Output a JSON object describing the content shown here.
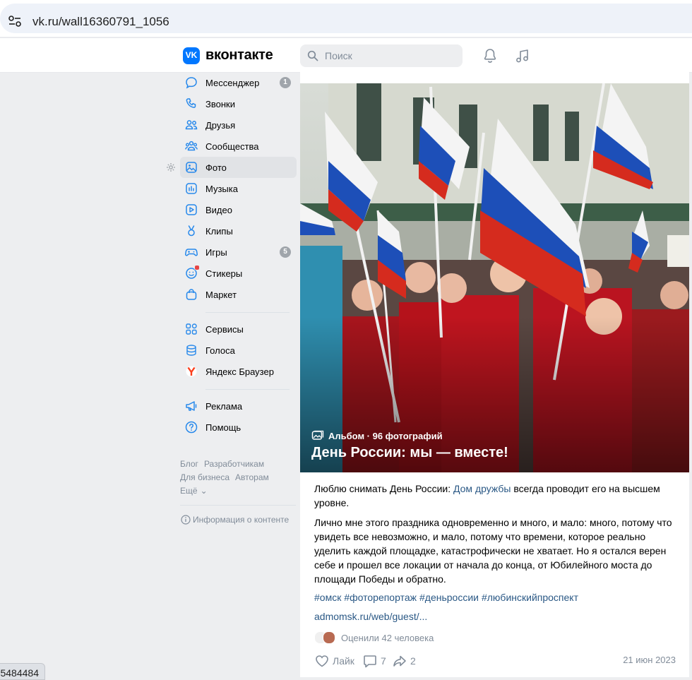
{
  "browser": {
    "url": "vk.ru/wall16360791_1056"
  },
  "header": {
    "logo_text": "вконтакте",
    "logo_mark": "VK",
    "search_placeholder": "Поиск"
  },
  "sidebar": {
    "items": [
      {
        "label": "Мессенджер",
        "icon": "chat-bubble-icon",
        "badge": "1"
      },
      {
        "label": "Звонки",
        "icon": "phone-icon"
      },
      {
        "label": "Друзья",
        "icon": "friends-icon"
      },
      {
        "label": "Сообщества",
        "icon": "communities-icon"
      },
      {
        "label": "Фото",
        "icon": "photo-icon",
        "active": true
      },
      {
        "label": "Музыка",
        "icon": "music-icon"
      },
      {
        "label": "Видео",
        "icon": "video-icon"
      },
      {
        "label": "Клипы",
        "icon": "clips-icon"
      },
      {
        "label": "Игры",
        "icon": "gamepad-icon",
        "badge": "5"
      },
      {
        "label": "Стикеры",
        "icon": "sticker-icon"
      },
      {
        "label": "Маркет",
        "icon": "market-bag-icon"
      }
    ],
    "items2": [
      {
        "label": "Сервисы",
        "icon": "services-grid-icon"
      },
      {
        "label": "Голоса",
        "icon": "coins-icon"
      },
      {
        "label": "Яндекс Браузер",
        "icon": "yandex-browser-icon"
      }
    ],
    "items3": [
      {
        "label": "Реклама",
        "icon": "megaphone-icon"
      },
      {
        "label": "Помощь",
        "icon": "help-icon"
      }
    ],
    "footer": {
      "blog": "Блог",
      "developers": "Разработчикам",
      "business": "Для бизнеса",
      "authors": "Авторам",
      "more": "Ещё"
    },
    "content_info": "Информация о контенте"
  },
  "post": {
    "album_meta": "Альбом · 96 фотографий",
    "album_title": "День России: мы — вместе!",
    "p1_before": "Люблю снимать День России: ",
    "p1_link": "Дом дружбы",
    "p1_after": " всегда проводит его на высшем уровне.",
    "p2": "Лично мне этого праздника одновременно и много, и мало: много, потому что увидеть все невозможно, и мало, потому что времени, которое реально уделить каждой площадке, катастрофически не хватает. Но я остался верен себе и прошел все локации от начала до конца, от Юбилейного моста до площади Победы и обратно.",
    "hashtags": [
      "#омск",
      "#фоторепортаж",
      "#деньроссии",
      "#любинскийпроспект"
    ],
    "ext_link": "admomsk.ru/web/guest/...",
    "likers_text": "Оценили 42 человека",
    "like_label": "Лайк",
    "comments_count": "7",
    "shares_count": "2",
    "date": "21 июн 2023"
  },
  "status_bar": {
    "text": "5484484"
  },
  "colors": {
    "accent": "#0077ff",
    "link": "#2a5885",
    "muted": "#818c99",
    "background": "#edeef0"
  }
}
